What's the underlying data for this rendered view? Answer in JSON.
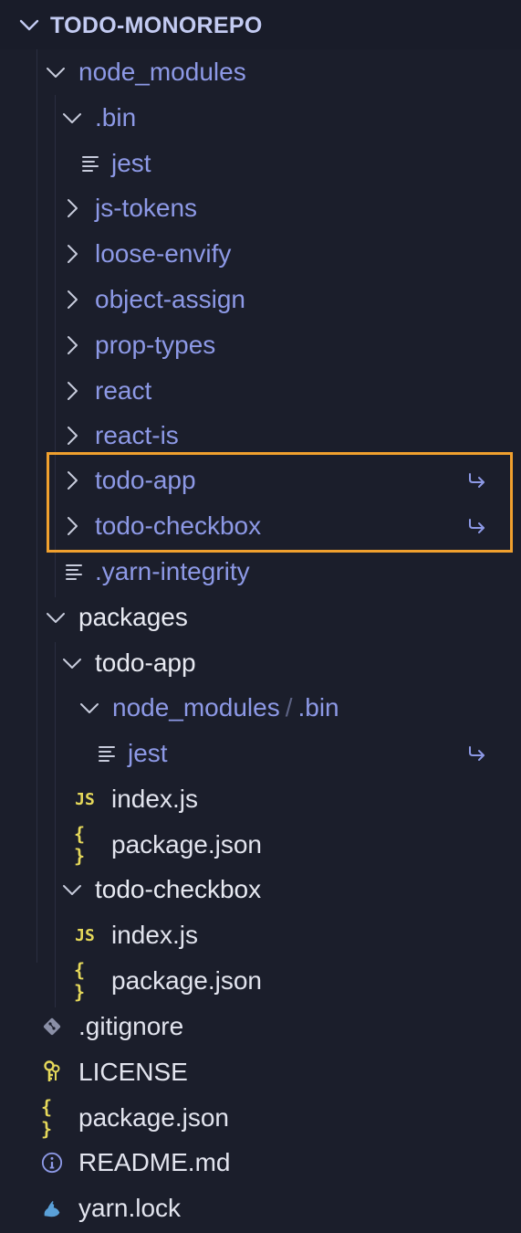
{
  "explorer": {
    "root_title": "TODO-MONOREPO",
    "items": [
      {
        "label": "node_modules",
        "kind": "folder",
        "state": "open"
      },
      {
        "label": ".bin",
        "kind": "folder",
        "state": "open"
      },
      {
        "label": "jest",
        "kind": "file",
        "icon": "lines-icon"
      },
      {
        "label": "js-tokens",
        "kind": "folder",
        "state": "closed"
      },
      {
        "label": "loose-envify",
        "kind": "folder",
        "state": "closed"
      },
      {
        "label": "object-assign",
        "kind": "folder",
        "state": "closed"
      },
      {
        "label": "prop-types",
        "kind": "folder",
        "state": "closed"
      },
      {
        "label": "react",
        "kind": "folder",
        "state": "closed"
      },
      {
        "label": "react-is",
        "kind": "folder",
        "state": "closed"
      },
      {
        "label": "todo-app",
        "kind": "folder",
        "state": "closed",
        "symlink": true
      },
      {
        "label": "todo-checkbox",
        "kind": "folder",
        "state": "closed",
        "symlink": true
      },
      {
        "label": ".yarn-integrity",
        "kind": "file",
        "icon": "lines-icon"
      },
      {
        "label": "packages",
        "kind": "folder",
        "state": "open"
      },
      {
        "label": "todo-app",
        "kind": "folder",
        "state": "open"
      },
      {
        "label": "node_modules",
        "label_suffix": ".bin",
        "separator": "/",
        "kind": "folder",
        "state": "open"
      },
      {
        "label": "jest",
        "kind": "file",
        "icon": "lines-icon",
        "symlink": true
      },
      {
        "label": "index.js",
        "kind": "file",
        "icon": "js-icon",
        "icon_text": "JS"
      },
      {
        "label": "package.json",
        "kind": "file",
        "icon": "braces-icon",
        "icon_text": "{ }"
      },
      {
        "label": "todo-checkbox",
        "kind": "folder",
        "state": "open"
      },
      {
        "label": "index.js",
        "kind": "file",
        "icon": "js-icon",
        "icon_text": "JS"
      },
      {
        "label": "package.json",
        "kind": "file",
        "icon": "braces-icon",
        "icon_text": "{ }"
      },
      {
        "label": ".gitignore",
        "kind": "file",
        "icon": "git-icon"
      },
      {
        "label": "LICENSE",
        "kind": "file",
        "icon": "license-icon"
      },
      {
        "label": "package.json",
        "kind": "file",
        "icon": "braces-icon",
        "icon_text": "{ }"
      },
      {
        "label": "README.md",
        "kind": "file",
        "icon": "info-icon"
      },
      {
        "label": "yarn.lock",
        "kind": "file",
        "icon": "yarn-icon"
      }
    ]
  },
  "colors": {
    "background": "#1b1e2b",
    "header_background": "#191c29",
    "link_text": "#8d99e6",
    "default_text": "#e2e4ee",
    "highlight_border": "#f0a02e",
    "js_icon": "#e5d85a",
    "braces_icon": "#e5d85a",
    "symlink_icon": "#8d99e6"
  }
}
